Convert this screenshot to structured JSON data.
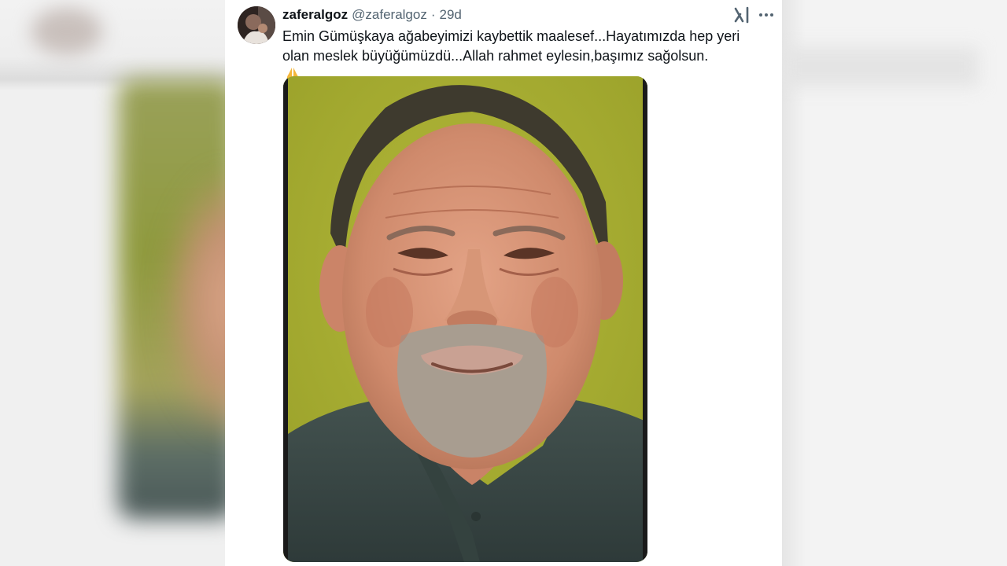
{
  "tweet": {
    "display_name": "zaferalgoz",
    "handle": "@zaferalgoz",
    "separator": "·",
    "time": "29d",
    "text_line1": "Emin Gümüşkaya ağabeyimizi kaybettik maalesef...Hayatımızda hep yeri",
    "text_line2": "olan meslek büyüğümüzdü...Allah rahmet eylesin,başımız sağolsun.",
    "emoji": "folded-hands-icon"
  },
  "icons": {
    "brand": "x-grok-icon",
    "more": "more-horizontal-icon"
  },
  "colors": {
    "text_primary": "#0f1419",
    "text_secondary": "#536471",
    "photo_background": "#a7ad30",
    "shirt": "#3c4a4a"
  }
}
